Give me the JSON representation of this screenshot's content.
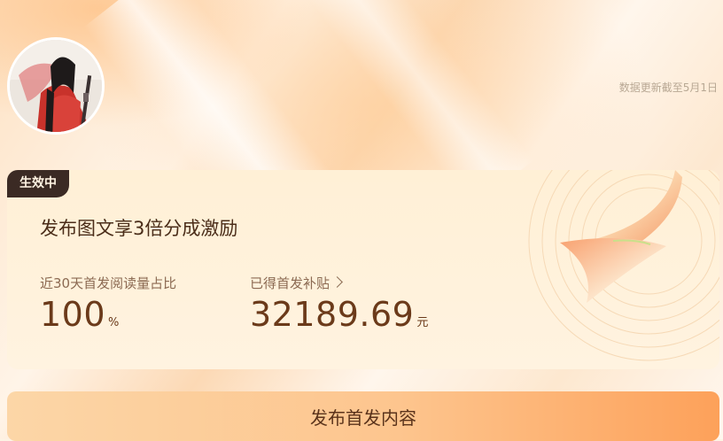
{
  "header": {
    "update_note": "数据更新截至5月1日"
  },
  "card": {
    "status_badge": "生效中",
    "title": "发布图文享3倍分成激励",
    "stat_ratio": {
      "label": "近30天首发阅读量占比",
      "value": "100",
      "unit": "%"
    },
    "stat_subsidy": {
      "label": "已得首发补贴",
      "value": "32189.69",
      "unit": "元"
    }
  },
  "cta": {
    "label": "发布首发内容"
  },
  "colors": {
    "badge_bg": "#3b2a24",
    "value_text": "#6b3a1a",
    "cta_gradient_end": "#fda15a"
  }
}
